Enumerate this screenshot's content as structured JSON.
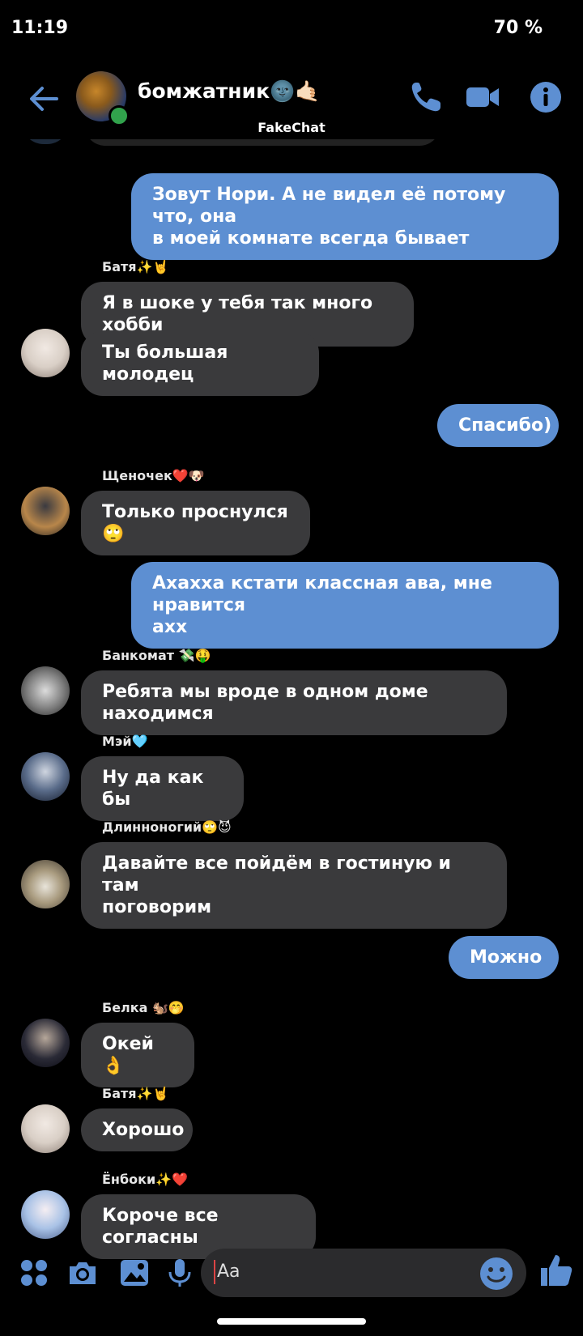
{
  "status_bar": {
    "time": "11:19",
    "battery": "70 %"
  },
  "header": {
    "title": "бомжатник🌚🤙🏻",
    "subtitle": "FakeChat",
    "accent_color": "#5d8fd2"
  },
  "messages": [
    {
      "type": "out",
      "text": "Зовут Нори. А не видел её потому что, она\nв моей комнате всегда бывает"
    },
    {
      "type": "sender",
      "text": "Батя✨🤘"
    },
    {
      "type": "in",
      "text": "Я в шоке у тебя так много хобби"
    },
    {
      "type": "in",
      "text": "Ты большая молодец"
    },
    {
      "type": "out",
      "text": "Спасибо)"
    },
    {
      "type": "sender",
      "text": "Щеночек❤️🐶"
    },
    {
      "type": "in",
      "text": "Только проснулся 🙄"
    },
    {
      "type": "out",
      "text": "Ахахха кстати классная ава, мне нравится\nахх"
    },
    {
      "type": "sender",
      "text": "Банкомат 💸🤑"
    },
    {
      "type": "in",
      "text": "Ребята мы вроде в одном доме находимся"
    },
    {
      "type": "sender",
      "text": "Мэй🩵"
    },
    {
      "type": "in",
      "text": "Ну да как бы"
    },
    {
      "type": "sender",
      "text": "Длинноногий🙄😈"
    },
    {
      "type": "in",
      "text": "Давайте все пойдём в гостиную и там\nпоговорим"
    },
    {
      "type": "out",
      "text": "Можно"
    },
    {
      "type": "sender",
      "text": "Белка 🐿️🤭"
    },
    {
      "type": "in",
      "text": "Окей 👌"
    },
    {
      "type": "sender",
      "text": "Батя✨🤘"
    },
    {
      "type": "in",
      "text": "Хорошо"
    },
    {
      "type": "sender",
      "text": "Ёнбоки✨❤️"
    },
    {
      "type": "in",
      "text": "Короче все согласны"
    }
  ],
  "composer": {
    "placeholder": "Aa"
  },
  "icons": [
    "back-arrow-icon",
    "phone-icon",
    "video-icon",
    "info-icon",
    "apps-icon",
    "camera-icon",
    "gallery-icon",
    "mic-icon",
    "emoji-icon",
    "like-icon"
  ]
}
